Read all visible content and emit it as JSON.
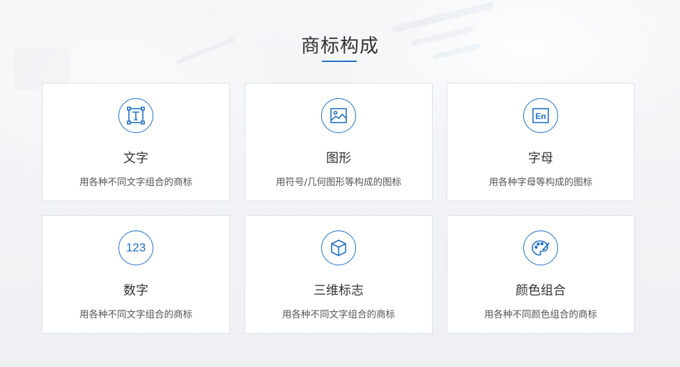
{
  "section": {
    "title": "商标构成"
  },
  "cards": [
    {
      "icon": "text-icon",
      "title": "文字",
      "desc": "用各种不同文字组合的商标"
    },
    {
      "icon": "image-icon",
      "title": "图形",
      "desc": "用符号/几何图形等构成的图标"
    },
    {
      "icon": "letters-icon",
      "title": "字母",
      "desc": "用各种字母等构成的图标",
      "glyph": "En"
    },
    {
      "icon": "numbers-icon",
      "title": "数字",
      "desc": "用各种不同文字组合的商标",
      "glyph": "123"
    },
    {
      "icon": "cube-icon",
      "title": "三维标志",
      "desc": "用各种不同文字组合的商标"
    },
    {
      "icon": "palette-icon",
      "title": "颜色组合",
      "desc": "用各种不同颜色组合的商标"
    }
  ],
  "colors": {
    "accent": "#1f6fc5",
    "title_text": "#333333",
    "desc_text": "#555555",
    "card_bg": "#ffffff",
    "card_border": "#d9e2ec"
  }
}
